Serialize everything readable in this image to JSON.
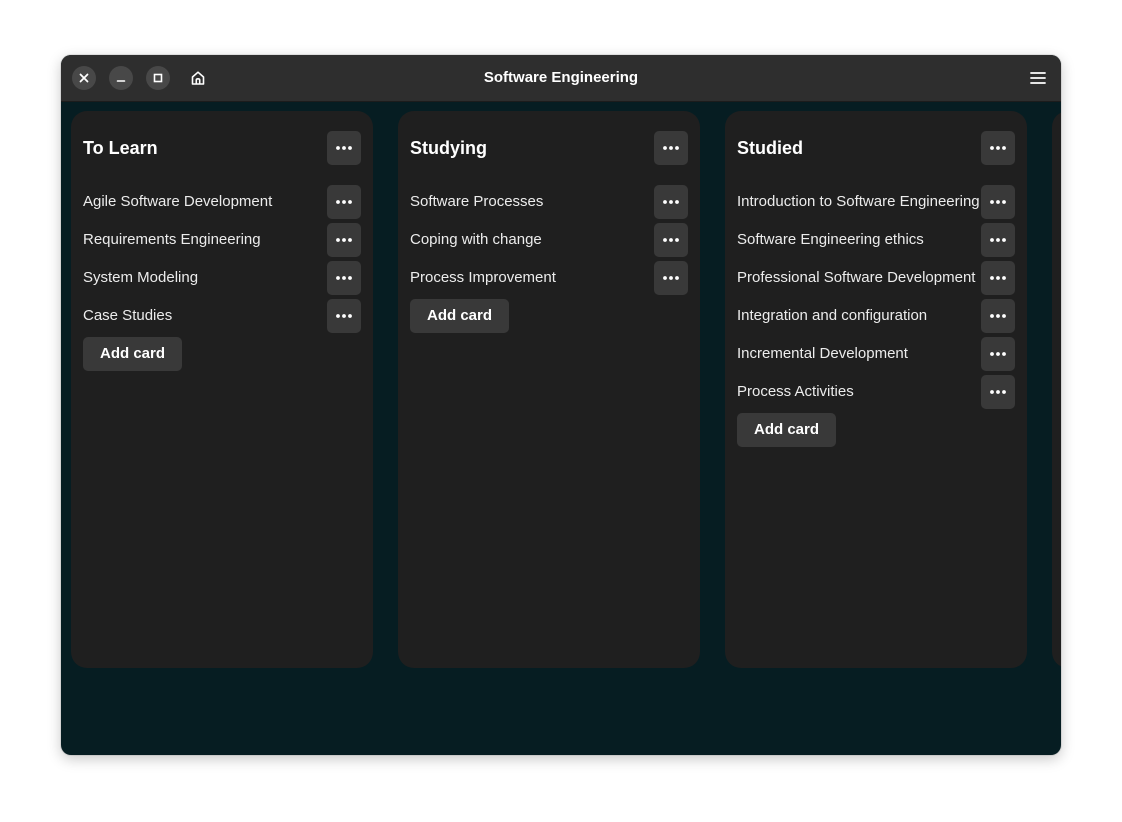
{
  "window": {
    "title": "Software Engineering",
    "controls": {
      "close_icon": "close-icon",
      "minimize_icon": "minimize-icon",
      "maximize_icon": "maximize-icon",
      "home_icon": "home-icon",
      "menu_icon": "hamburger-menu-icon"
    }
  },
  "colors": {
    "background": "#061d22",
    "titlebar": "#2e2e2e",
    "column": "#1f1f1f",
    "button": "#393939",
    "text": "#ffffff"
  },
  "board": {
    "add_card_label": "Add card",
    "columns": [
      {
        "title": "To Learn",
        "cards": [
          "Agile Software Development",
          "Requirements Engineering",
          "System Modeling",
          "Case Studies"
        ]
      },
      {
        "title": "Studying",
        "cards": [
          "Software Processes",
          "Coping with change",
          "Process Improvement"
        ]
      },
      {
        "title": "Studied",
        "cards": [
          "Introduction to Software Engineering",
          "Software Engineering ethics",
          "Professional Software Development",
          "Integration and configuration",
          "Incremental Development",
          "Process Activities"
        ]
      }
    ]
  }
}
